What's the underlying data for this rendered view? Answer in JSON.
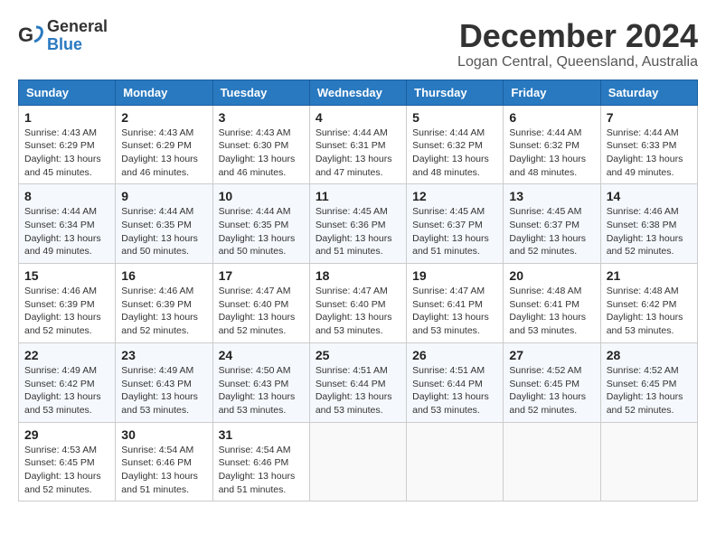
{
  "logo": {
    "text_general": "General",
    "text_blue": "Blue"
  },
  "header": {
    "month_year": "December 2024",
    "location": "Logan Central, Queensland, Australia"
  },
  "weekdays": [
    "Sunday",
    "Monday",
    "Tuesday",
    "Wednesday",
    "Thursday",
    "Friday",
    "Saturday"
  ],
  "weeks": [
    [
      {
        "day": "1",
        "sunrise": "4:43 AM",
        "sunset": "6:29 PM",
        "daylight": "13 hours and 45 minutes."
      },
      {
        "day": "2",
        "sunrise": "4:43 AM",
        "sunset": "6:29 PM",
        "daylight": "13 hours and 46 minutes."
      },
      {
        "day": "3",
        "sunrise": "4:43 AM",
        "sunset": "6:30 PM",
        "daylight": "13 hours and 46 minutes."
      },
      {
        "day": "4",
        "sunrise": "4:44 AM",
        "sunset": "6:31 PM",
        "daylight": "13 hours and 47 minutes."
      },
      {
        "day": "5",
        "sunrise": "4:44 AM",
        "sunset": "6:32 PM",
        "daylight": "13 hours and 48 minutes."
      },
      {
        "day": "6",
        "sunrise": "4:44 AM",
        "sunset": "6:32 PM",
        "daylight": "13 hours and 48 minutes."
      },
      {
        "day": "7",
        "sunrise": "4:44 AM",
        "sunset": "6:33 PM",
        "daylight": "13 hours and 49 minutes."
      }
    ],
    [
      {
        "day": "8",
        "sunrise": "4:44 AM",
        "sunset": "6:34 PM",
        "daylight": "13 hours and 49 minutes."
      },
      {
        "day": "9",
        "sunrise": "4:44 AM",
        "sunset": "6:35 PM",
        "daylight": "13 hours and 50 minutes."
      },
      {
        "day": "10",
        "sunrise": "4:44 AM",
        "sunset": "6:35 PM",
        "daylight": "13 hours and 50 minutes."
      },
      {
        "day": "11",
        "sunrise": "4:45 AM",
        "sunset": "6:36 PM",
        "daylight": "13 hours and 51 minutes."
      },
      {
        "day": "12",
        "sunrise": "4:45 AM",
        "sunset": "6:37 PM",
        "daylight": "13 hours and 51 minutes."
      },
      {
        "day": "13",
        "sunrise": "4:45 AM",
        "sunset": "6:37 PM",
        "daylight": "13 hours and 52 minutes."
      },
      {
        "day": "14",
        "sunrise": "4:46 AM",
        "sunset": "6:38 PM",
        "daylight": "13 hours and 52 minutes."
      }
    ],
    [
      {
        "day": "15",
        "sunrise": "4:46 AM",
        "sunset": "6:39 PM",
        "daylight": "13 hours and 52 minutes."
      },
      {
        "day": "16",
        "sunrise": "4:46 AM",
        "sunset": "6:39 PM",
        "daylight": "13 hours and 52 minutes."
      },
      {
        "day": "17",
        "sunrise": "4:47 AM",
        "sunset": "6:40 PM",
        "daylight": "13 hours and 52 minutes."
      },
      {
        "day": "18",
        "sunrise": "4:47 AM",
        "sunset": "6:40 PM",
        "daylight": "13 hours and 53 minutes."
      },
      {
        "day": "19",
        "sunrise": "4:47 AM",
        "sunset": "6:41 PM",
        "daylight": "13 hours and 53 minutes."
      },
      {
        "day": "20",
        "sunrise": "4:48 AM",
        "sunset": "6:41 PM",
        "daylight": "13 hours and 53 minutes."
      },
      {
        "day": "21",
        "sunrise": "4:48 AM",
        "sunset": "6:42 PM",
        "daylight": "13 hours and 53 minutes."
      }
    ],
    [
      {
        "day": "22",
        "sunrise": "4:49 AM",
        "sunset": "6:42 PM",
        "daylight": "13 hours and 53 minutes."
      },
      {
        "day": "23",
        "sunrise": "4:49 AM",
        "sunset": "6:43 PM",
        "daylight": "13 hours and 53 minutes."
      },
      {
        "day": "24",
        "sunrise": "4:50 AM",
        "sunset": "6:43 PM",
        "daylight": "13 hours and 53 minutes."
      },
      {
        "day": "25",
        "sunrise": "4:51 AM",
        "sunset": "6:44 PM",
        "daylight": "13 hours and 53 minutes."
      },
      {
        "day": "26",
        "sunrise": "4:51 AM",
        "sunset": "6:44 PM",
        "daylight": "13 hours and 53 minutes."
      },
      {
        "day": "27",
        "sunrise": "4:52 AM",
        "sunset": "6:45 PM",
        "daylight": "13 hours and 52 minutes."
      },
      {
        "day": "28",
        "sunrise": "4:52 AM",
        "sunset": "6:45 PM",
        "daylight": "13 hours and 52 minutes."
      }
    ],
    [
      {
        "day": "29",
        "sunrise": "4:53 AM",
        "sunset": "6:45 PM",
        "daylight": "13 hours and 52 minutes."
      },
      {
        "day": "30",
        "sunrise": "4:54 AM",
        "sunset": "6:46 PM",
        "daylight": "13 hours and 51 minutes."
      },
      {
        "day": "31",
        "sunrise": "4:54 AM",
        "sunset": "6:46 PM",
        "daylight": "13 hours and 51 minutes."
      },
      null,
      null,
      null,
      null
    ]
  ],
  "labels": {
    "sunrise_prefix": "Sunrise: ",
    "sunset_prefix": "Sunset: ",
    "daylight_prefix": "Daylight: "
  }
}
